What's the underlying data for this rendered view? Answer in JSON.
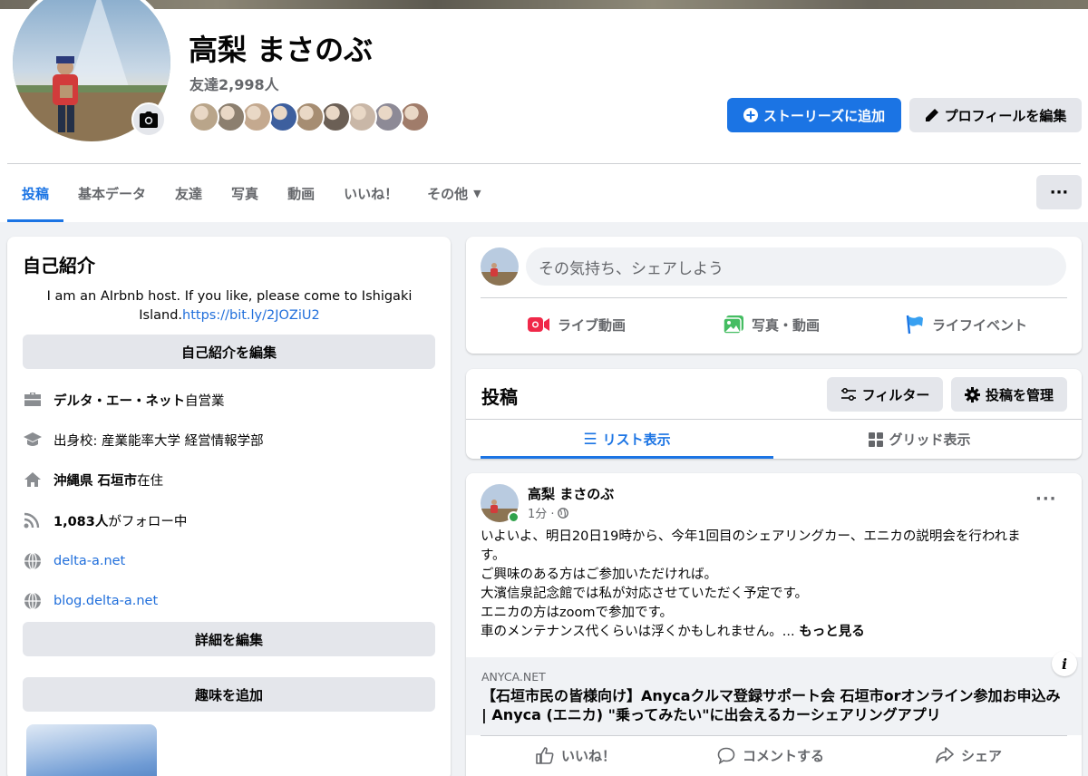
{
  "profile": {
    "name": "高梨 まさのぶ",
    "friend_count": "友達2,998人",
    "friend_avatar_colors": [
      "#b9a58a",
      "#8c7f6f",
      "#c4a98f",
      "#3d5f9e",
      "#a68d72",
      "#6b5f55",
      "#c9b7a7",
      "#8d8a96",
      "#a07c6a"
    ]
  },
  "header": {
    "add_story_label": "ストーリーズに追加",
    "edit_profile_label": "プロフィールを編集",
    "more_dots": "···"
  },
  "tabs": [
    {
      "label": "投稿"
    },
    {
      "label": "基本データ"
    },
    {
      "label": "友達"
    },
    {
      "label": "写真"
    },
    {
      "label": "動画"
    },
    {
      "label": "いいね！"
    },
    {
      "label": "その他"
    }
  ],
  "intro": {
    "title": "自己紹介",
    "bio_text": "I am an AIrbnb host. If you like, please come to Ishigaki Island.",
    "bio_link": "https://bit.ly/2JOZiU2",
    "edit_bio_label": "自己紹介を編集",
    "work_bold": "デルタ・エー・ネット",
    "work_rest": " 自営業",
    "education": "出身校: 産業能率大学 経営情報学部",
    "location_bold": "沖縄県 石垣市",
    "location_rest": "在住",
    "followers_bold": "1,083人",
    "followers_rest": "がフォロー中",
    "website1": "delta-a.net",
    "website2": "blog.delta-a.net",
    "edit_details_label": "詳細を編集",
    "add_hobby_label": "趣味を追加"
  },
  "composer": {
    "placeholder": "その気持ち、シェアしよう",
    "live_label": "ライブ動画",
    "photo_label": "写真・動画",
    "life_event_label": "ライフイベント"
  },
  "posts_header": {
    "title": "投稿",
    "filter_label": "フィルター",
    "manage_label": "投稿を管理",
    "list_view_label": "リスト表示",
    "grid_view_label": "グリッド表示"
  },
  "post": {
    "author": "高梨 まさのぶ",
    "time": "1分 ·",
    "more_dots": "···",
    "lines": [
      "いよいよ、明日20日19時から、今年1回目のシェアリングカー、エニカの説明会を行われま",
      "す。",
      "ご興味のある方はご参加いただければ。",
      "大濱信泉記念館では私が対応させていただく予定です。",
      "エニカの方はzoomで参加です。",
      "車のメンテナンス代くらいは浮くかもしれません。... "
    ],
    "see_more": "もっと見る",
    "link_domain": "ANYCA.NET",
    "link_title": "【石垣市民の皆様向け】Anycaクルマ登録サポート会 石垣市orオンライン参加お申込み | Anyca (エニカ) \"乗ってみたい\"に出会えるカーシェアリングアプリ",
    "info_glyph": "i",
    "like_label": "いいね！",
    "comment_label": "コメントする",
    "share_label": "シェア"
  },
  "colors": {
    "accent": "#1b74e4",
    "background": "#f0f2f5",
    "card": "#ffffff",
    "secondary_text": "#65676b",
    "live_red": "#f02849",
    "photo_green": "#45bd62",
    "event_blue": "#1b74e4"
  }
}
